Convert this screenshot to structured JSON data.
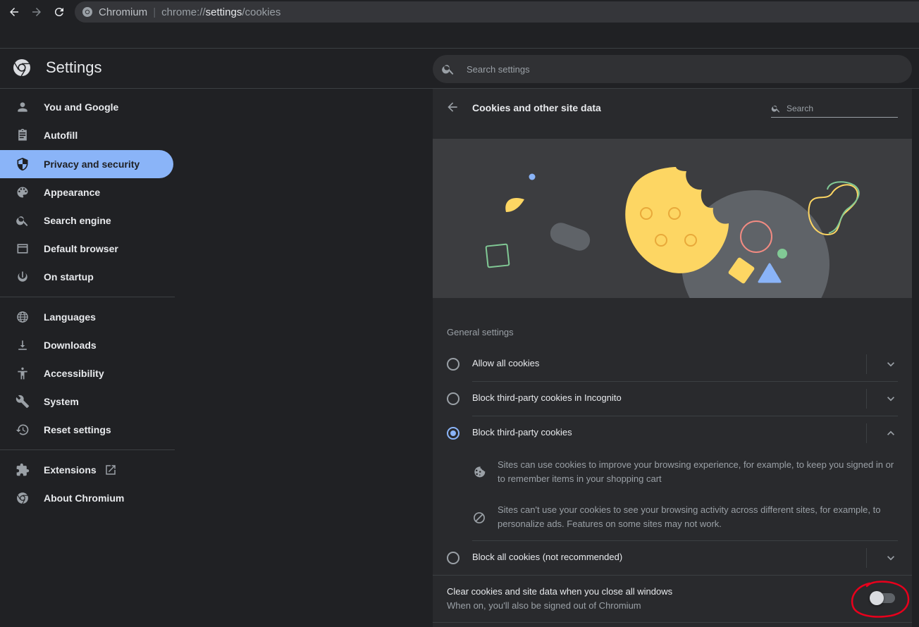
{
  "browser": {
    "site_name": "Chromium",
    "url_prefix": "chrome://",
    "url_host": "settings",
    "url_path": "/cookies"
  },
  "header": {
    "title": "Settings",
    "search_placeholder": "Search settings"
  },
  "sidebar": {
    "items": [
      {
        "label": "You and Google",
        "icon": "person-icon"
      },
      {
        "label": "Autofill",
        "icon": "clipboard-icon"
      },
      {
        "label": "Privacy and security",
        "icon": "shield-icon",
        "active": true
      },
      {
        "label": "Appearance",
        "icon": "palette-icon"
      },
      {
        "label": "Search engine",
        "icon": "search-icon"
      },
      {
        "label": "Default browser",
        "icon": "browser-window-icon"
      },
      {
        "label": "On startup",
        "icon": "power-icon"
      },
      {
        "label": "Languages",
        "icon": "globe-icon"
      },
      {
        "label": "Downloads",
        "icon": "download-icon"
      },
      {
        "label": "Accessibility",
        "icon": "accessibility-icon"
      },
      {
        "label": "System",
        "icon": "wrench-icon"
      },
      {
        "label": "Reset settings",
        "icon": "history-icon"
      },
      {
        "label": "Extensions",
        "icon": "puzzle-icon"
      },
      {
        "label": "About Chromium",
        "icon": "chromium-icon"
      }
    ]
  },
  "page": {
    "title": "Cookies and other site data",
    "search_placeholder": "Search",
    "general_heading": "General settings",
    "options": [
      {
        "label": "Allow all cookies",
        "selected": false,
        "expanded": false
      },
      {
        "label": "Block third-party cookies in Incognito",
        "selected": false,
        "expanded": false
      },
      {
        "label": "Block third-party cookies",
        "selected": true,
        "expanded": true
      },
      {
        "label": "Block all cookies (not recommended)",
        "selected": false,
        "expanded": false
      }
    ],
    "details": [
      {
        "text": "Sites can use cookies to improve your browsing experience, for example, to keep you signed in or to remember items in your shopping cart",
        "icon": "cookie-icon"
      },
      {
        "text": "Sites can't use your cookies to see your browsing activity across different sites, for example, to personalize ads. Features on some sites may not work.",
        "icon": "block-icon"
      }
    ],
    "clear_on_exit": {
      "title": "Clear cookies and site data when you close all windows",
      "subtitle": "When on, you'll also be signed out of Chromium",
      "enabled": false
    }
  },
  "colors": {
    "accent": "#8ab4f8",
    "background": "#202124",
    "card": "#292a2d",
    "annotation": "#e8001c"
  }
}
